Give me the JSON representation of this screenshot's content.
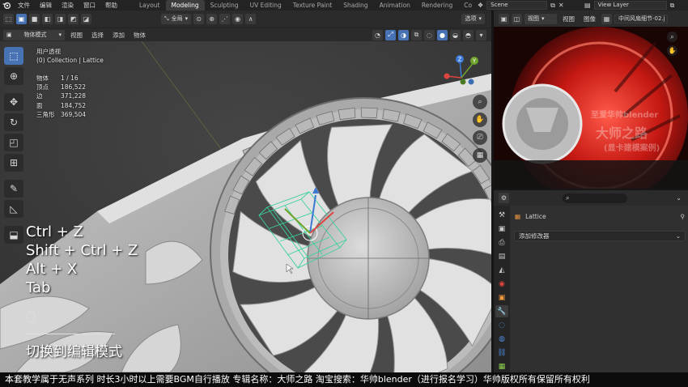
{
  "menubar": {
    "items": [
      "文件",
      "编辑",
      "渲染",
      "窗口",
      "帮助"
    ],
    "workspaces": [
      "Layout",
      "Modeling",
      "Sculpting",
      "UV Editing",
      "Texture Paint",
      "Shading",
      "Animation",
      "Rendering",
      "Co"
    ],
    "active_workspace": "Modeling",
    "scene": "Scene",
    "view_layer": "View Layer"
  },
  "viewport_header": {
    "transform_orientation": "全局",
    "options_label": "选项",
    "mode": "物体模式",
    "menus": [
      "视图",
      "选择",
      "添加",
      "物体"
    ]
  },
  "viewport": {
    "view_name": "用户透视",
    "collection": "(0) Collection | Lattice",
    "stats": [
      {
        "label": "物体",
        "value": "1 / 16"
      },
      {
        "label": "顶点",
        "value": "186,522"
      },
      {
        "label": "边",
        "value": "371,228"
      },
      {
        "label": "面",
        "value": "184,752"
      },
      {
        "label": "三角形",
        "value": "369,504"
      }
    ],
    "gizmo_axes": {
      "x": "X",
      "y": "Y",
      "z": "Z"
    },
    "shortcuts": [
      "Ctrl + Z",
      "Shift + Ctrl + Z",
      "Alt + X",
      "Tab"
    ],
    "caption": "切换到编辑模式"
  },
  "image_editor": {
    "menus": [
      "视图",
      "图像"
    ],
    "image_name": "中间风扇细节-02.j",
    "watermark_1": "至爱华帅blender",
    "watermark_2": "大师之路",
    "watermark_3": "(显卡建模案例)"
  },
  "properties": {
    "object_name": "Lattice",
    "add_modifier": "添加修改器"
  },
  "footer": {
    "notice": "本套教学属于无声系列 时长3小时以上需要BGM自行播放  专辑名称：大师之路  淘宝搜索：华帅blender（进行报名学习）华帅版权所有保留所有权利"
  },
  "colors": {
    "accent": "#4772b3",
    "axis_x": "#e0443e",
    "axis_y": "#6ea22a",
    "axis_z": "#3a78d4",
    "lattice": "#3ad39a"
  }
}
